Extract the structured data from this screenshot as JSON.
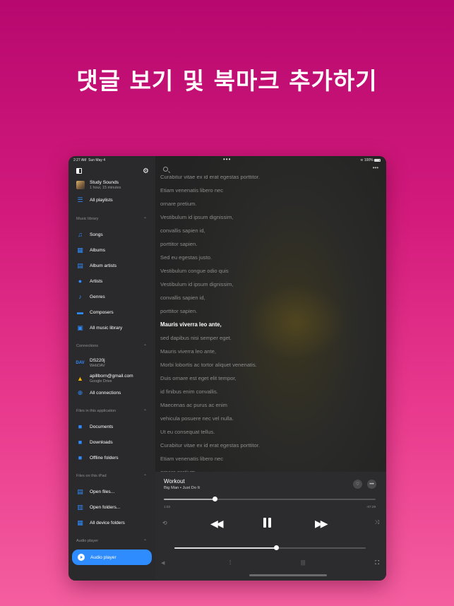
{
  "headline": "댓글 보기 및 북마크 추가하기",
  "status": {
    "time": "2:27 AM",
    "date": "Sun May 4",
    "battery": "100%"
  },
  "sidebar": {
    "now_playing": {
      "title": "Study Sounds",
      "duration": "1 hour, 15 minutes"
    },
    "all_playlists": "All playlists",
    "music_library_header": "Music library",
    "music_library": [
      "Songs",
      "Albums",
      "Album artists",
      "Artists",
      "Genres",
      "Composers",
      "All music library"
    ],
    "connections_header": "Connections",
    "connections": [
      {
        "title": "DS220j",
        "subtitle": "WebDAV"
      },
      {
        "title": "apillborn@gmail.com",
        "subtitle": "Google Drive"
      }
    ],
    "all_connections": "All connections",
    "files_app_header": "Files in this application",
    "files_app": [
      "Documents",
      "Downloads",
      "Offline folders"
    ],
    "files_ipad_header": "Files on this iPad",
    "files_ipad": [
      "Open files...",
      "Open folders...",
      "All device folders"
    ],
    "audio_player_header": "Audio player",
    "audio_player": "Audio player"
  },
  "lyrics": {
    "active_index": 11,
    "lines": [
      "Curabitur vitae ex id erat egestas porttitor.",
      "Etiam venenatis libero nec",
      "ornare pretium.",
      "Vestibulum id ipsum dignissim,",
      "convallis sapien id,",
      "porttitor sapien.",
      "Sed eu egestas justo.",
      "Vestibulum congue odio quis",
      "Vestibulum id ipsum dignissim,",
      "convallis sapien id,",
      "porttitor sapien.",
      "Mauris viverra leo ante,",
      "sed dapibus nisi semper eget.",
      "Mauris viverra leo ante,",
      "Morbi lobortis ac tortor aliquet venenatis.",
      "Duis ornare est eget elit tempor,",
      "id finibus enim convallis.",
      "Maecenas ac purus ac enim",
      "vehicula posuere nec vel nulla.",
      "Ut eu consequat tellus.",
      "Curabitur vitae ex id erat egestas porttitor.",
      "Etiam venenatis libero nec",
      "ornare pretium."
    ]
  },
  "player": {
    "title": "Workout",
    "subtitle": "Big Man • Just Do It",
    "elapsed": "1:03",
    "remaining": "-07:29",
    "progress": 0.24,
    "volume": 0.53
  },
  "colors": {
    "accent": "#2f8cff",
    "sidebar_bg": "#2a2a2c"
  }
}
